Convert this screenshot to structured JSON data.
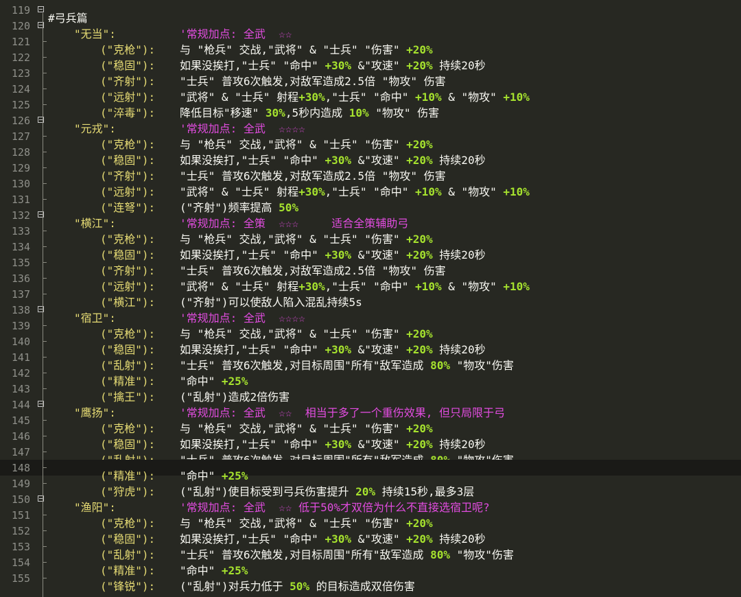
{
  "editor": {
    "lines": [
      {
        "n": "119",
        "fold": true,
        "segs": [
          [
            "header",
            "#弓兵篇"
          ]
        ]
      },
      {
        "n": "120",
        "fold": true,
        "segs": [
          [
            "name",
            "\"无当\":"
          ],
          [
            "sp",
            ""
          ],
          [
            "magenta",
            "'常规加点: 全武"
          ],
          [
            "magenta",
            "  ☆☆"
          ]
        ]
      },
      {
        "n": "121",
        "segs": [
          [
            "sub",
            "(\"克枪\"):"
          ],
          [
            "plain",
            "与 \"枪兵\" 交战,\"武将\" & \"士兵\" \"伤害\" "
          ],
          [
            "num",
            "+20%"
          ]
        ]
      },
      {
        "n": "122",
        "segs": [
          [
            "sub",
            "(\"稳固\"):"
          ],
          [
            "plain",
            "如果没挨打,\"士兵\" \"命中\" "
          ],
          [
            "num",
            "+30%"
          ],
          [
            "plain",
            " &\"攻速\" "
          ],
          [
            "num",
            "+20%"
          ],
          [
            "plain",
            " 持续20秒"
          ]
        ]
      },
      {
        "n": "123",
        "segs": [
          [
            "sub",
            "(\"齐射\"):"
          ],
          [
            "plain",
            "\"士兵\" 普攻6次触发,对敌军造成2.5倍 \"物攻\" 伤害"
          ]
        ]
      },
      {
        "n": "124",
        "segs": [
          [
            "sub",
            "(\"远射\"):"
          ],
          [
            "plain",
            "\"武将\" & \"士兵\" 射程"
          ],
          [
            "num",
            "+30%"
          ],
          [
            "plain",
            ",\"士兵\" \"命中\" "
          ],
          [
            "num",
            "+10%"
          ],
          [
            "plain",
            " & \"物攻\" "
          ],
          [
            "num",
            "+10%"
          ]
        ]
      },
      {
        "n": "125",
        "segs": [
          [
            "sub",
            "(\"淬毒\"):"
          ],
          [
            "plain",
            "降低目标\"移速\" "
          ],
          [
            "num",
            "30%"
          ],
          [
            "plain",
            ",5秒内造成 "
          ],
          [
            "num",
            "10%"
          ],
          [
            "plain",
            " \"物攻\" 伤害"
          ]
        ]
      },
      {
        "n": "126",
        "fold": true,
        "segs": [
          [
            "name",
            "\"元戎\":"
          ],
          [
            "sp",
            ""
          ],
          [
            "magenta",
            "'常规加点: 全武"
          ],
          [
            "magenta",
            "  ☆☆☆☆"
          ]
        ]
      },
      {
        "n": "127",
        "segs": [
          [
            "sub",
            "(\"克枪\"):"
          ],
          [
            "plain",
            "与 \"枪兵\" 交战,\"武将\" & \"士兵\" \"伤害\" "
          ],
          [
            "num",
            "+20%"
          ]
        ]
      },
      {
        "n": "128",
        "segs": [
          [
            "sub",
            "(\"稳固\"):"
          ],
          [
            "plain",
            "如果没挨打,\"士兵\" \"命中\" "
          ],
          [
            "num",
            "+30%"
          ],
          [
            "plain",
            " &\"攻速\" "
          ],
          [
            "num",
            "+20%"
          ],
          [
            "plain",
            " 持续20秒"
          ]
        ]
      },
      {
        "n": "129",
        "segs": [
          [
            "sub",
            "(\"齐射\"):"
          ],
          [
            "plain",
            "\"士兵\" 普攻6次触发,对敌军造成2.5倍 \"物攻\" 伤害"
          ]
        ]
      },
      {
        "n": "130",
        "segs": [
          [
            "sub",
            "(\"远射\"):"
          ],
          [
            "plain",
            "\"武将\" & \"士兵\" 射程"
          ],
          [
            "num",
            "+30%"
          ],
          [
            "plain",
            ",\"士兵\" \"命中\" "
          ],
          [
            "num",
            "+10%"
          ],
          [
            "plain",
            " & \"物攻\" "
          ],
          [
            "num",
            "+10%"
          ]
        ]
      },
      {
        "n": "131",
        "segs": [
          [
            "sub",
            "(\"连弩\"):"
          ],
          [
            "plain",
            "(\"齐射\")频率提高 "
          ],
          [
            "num",
            "50%"
          ]
        ]
      },
      {
        "n": "132",
        "fold": true,
        "segs": [
          [
            "name",
            "\"横江\":"
          ],
          [
            "sp",
            ""
          ],
          [
            "magenta",
            "'常规加点: 全策"
          ],
          [
            "magenta",
            "  ☆☆☆"
          ],
          [
            "magenta",
            "     适合全策辅助弓"
          ]
        ]
      },
      {
        "n": "133",
        "segs": [
          [
            "sub",
            "(\"克枪\"):"
          ],
          [
            "plain",
            "与 \"枪兵\" 交战,\"武将\" & \"士兵\" \"伤害\" "
          ],
          [
            "num",
            "+20%"
          ]
        ]
      },
      {
        "n": "134",
        "segs": [
          [
            "sub",
            "(\"稳固\"):"
          ],
          [
            "plain",
            "如果没挨打,\"士兵\" \"命中\" "
          ],
          [
            "num",
            "+30%"
          ],
          [
            "plain",
            " &\"攻速\" "
          ],
          [
            "num",
            "+20%"
          ],
          [
            "plain",
            " 持续20秒"
          ]
        ]
      },
      {
        "n": "135",
        "segs": [
          [
            "sub",
            "(\"齐射\"):"
          ],
          [
            "plain",
            "\"士兵\" 普攻6次触发,对敌军造成2.5倍 \"物攻\" 伤害"
          ]
        ]
      },
      {
        "n": "136",
        "segs": [
          [
            "sub",
            "(\"远射\"):"
          ],
          [
            "plain",
            "\"武将\" & \"士兵\" 射程"
          ],
          [
            "num",
            "+30%"
          ],
          [
            "plain",
            ",\"士兵\" \"命中\" "
          ],
          [
            "num",
            "+10%"
          ],
          [
            "plain",
            " & \"物攻\" "
          ],
          [
            "num",
            "+10%"
          ]
        ]
      },
      {
        "n": "137",
        "segs": [
          [
            "sub",
            "(\"横江\"):"
          ],
          [
            "plain",
            "(\"齐射\")可以使敌人陷入混乱持续5s"
          ]
        ]
      },
      {
        "n": "138",
        "fold": true,
        "segs": [
          [
            "name",
            "\"宿卫\":"
          ],
          [
            "sp",
            ""
          ],
          [
            "magenta",
            "'常规加点: 全武"
          ],
          [
            "magenta",
            "  ☆☆☆☆"
          ]
        ]
      },
      {
        "n": "139",
        "segs": [
          [
            "sub",
            "(\"克枪\"):"
          ],
          [
            "plain",
            "与 \"枪兵\" 交战,\"武将\" & \"士兵\" \"伤害\" "
          ],
          [
            "num",
            "+20%"
          ]
        ]
      },
      {
        "n": "140",
        "segs": [
          [
            "sub",
            "(\"稳固\"):"
          ],
          [
            "plain",
            "如果没挨打,\"士兵\" \"命中\" "
          ],
          [
            "num",
            "+30%"
          ],
          [
            "plain",
            " &\"攻速\" "
          ],
          [
            "num",
            "+20%"
          ],
          [
            "plain",
            " 持续20秒"
          ]
        ]
      },
      {
        "n": "141",
        "segs": [
          [
            "sub",
            "(\"乱射\"):"
          ],
          [
            "plain",
            "\"士兵\" 普攻6次触发,对目标周围\"所有\"敌军造成 "
          ],
          [
            "num",
            "80%"
          ],
          [
            "plain",
            " \"物攻\"伤害"
          ]
        ]
      },
      {
        "n": "142",
        "segs": [
          [
            "sub",
            "(\"精准\"):"
          ],
          [
            "plain",
            "\"命中\" "
          ],
          [
            "num",
            "+25%"
          ]
        ]
      },
      {
        "n": "143",
        "segs": [
          [
            "sub",
            "(\"擒王\"):"
          ],
          [
            "plain",
            "(\"乱射\")造成2倍伤害"
          ]
        ]
      },
      {
        "n": "144",
        "fold": true,
        "segs": [
          [
            "name",
            "\"鹰扬\":"
          ],
          [
            "sp",
            ""
          ],
          [
            "magenta",
            "'常规加点: 全武"
          ],
          [
            "magenta",
            "  ☆☆"
          ],
          [
            "magenta",
            "  相当于多了一个重伤效果, 但只局限于弓"
          ]
        ]
      },
      {
        "n": "145",
        "segs": [
          [
            "sub",
            "(\"克枪\"):"
          ],
          [
            "plain",
            "与 \"枪兵\" 交战,\"武将\" & \"士兵\" \"伤害\" "
          ],
          [
            "num",
            "+20%"
          ]
        ]
      },
      {
        "n": "146",
        "segs": [
          [
            "sub",
            "(\"稳固\"):"
          ],
          [
            "plain",
            "如果没挨打,\"士兵\" \"命中\" "
          ],
          [
            "num",
            "+30%"
          ],
          [
            "plain",
            " &\"攻速\" "
          ],
          [
            "num",
            "+20%"
          ],
          [
            "plain",
            " 持续20秒"
          ]
        ]
      },
      {
        "n": "147",
        "segs": [
          [
            "sub",
            "(\"乱射\"):"
          ],
          [
            "plain",
            "\"士兵\" 普攻6次触发,对目标周围\"所有\"敌军造成 "
          ],
          [
            "num",
            "80%"
          ],
          [
            "plain",
            " \"物攻\"伤害"
          ]
        ]
      },
      {
        "n": "148",
        "cur": true,
        "segs": [
          [
            "sub",
            "(\"精准\"):"
          ],
          [
            "plain",
            "\"命中\" "
          ],
          [
            "num",
            "+25%"
          ]
        ]
      },
      {
        "n": "149",
        "segs": [
          [
            "sub",
            "(\"狩虎\"):"
          ],
          [
            "plain",
            "(\"乱射\")使目标受到弓兵伤害提升 "
          ],
          [
            "num",
            "20%"
          ],
          [
            "plain",
            " 持续15秒,最多3层"
          ]
        ]
      },
      {
        "n": "150",
        "fold": true,
        "segs": [
          [
            "name",
            "\"渔阳\":"
          ],
          [
            "sp",
            ""
          ],
          [
            "magenta",
            "'常规加点: 全武"
          ],
          [
            "magenta",
            "  ☆☆"
          ],
          [
            "magenta",
            " 低于50%才双倍为什么不直接选宿卫呢?"
          ]
        ]
      },
      {
        "n": "151",
        "segs": [
          [
            "sub",
            "(\"克枪\"):"
          ],
          [
            "plain",
            "与 \"枪兵\" 交战,\"武将\" & \"士兵\" \"伤害\" "
          ],
          [
            "num",
            "+20%"
          ]
        ]
      },
      {
        "n": "152",
        "segs": [
          [
            "sub",
            "(\"稳固\"):"
          ],
          [
            "plain",
            "如果没挨打,\"士兵\" \"命中\" "
          ],
          [
            "num",
            "+30%"
          ],
          [
            "plain",
            " &\"攻速\" "
          ],
          [
            "num",
            "+20%"
          ],
          [
            "plain",
            " 持续20秒"
          ]
        ]
      },
      {
        "n": "153",
        "segs": [
          [
            "sub",
            "(\"乱射\"):"
          ],
          [
            "plain",
            "\"士兵\" 普攻6次触发,对目标周围\"所有\"敌军造成 "
          ],
          [
            "num",
            "80%"
          ],
          [
            "plain",
            " \"物攻\"伤害"
          ]
        ]
      },
      {
        "n": "154",
        "segs": [
          [
            "sub",
            "(\"精准\"):"
          ],
          [
            "plain",
            "\"命中\" "
          ],
          [
            "num",
            "+25%"
          ]
        ]
      },
      {
        "n": "155",
        "segs": [
          [
            "sub",
            "(\"锋锐\"):"
          ],
          [
            "plain",
            "(\"乱射\")对兵力低于 "
          ],
          [
            "num",
            "50%"
          ],
          [
            "plain",
            " 的目标造成双倍伤害"
          ]
        ]
      }
    ]
  },
  "colors": {
    "background": "#272822",
    "line_number": "#8f908a",
    "string": "#e6db74",
    "text": "#f8f8f2",
    "number": "#a6e22e",
    "comment_magenta": "#e24ce0",
    "current_line": "#1a1a17"
  }
}
